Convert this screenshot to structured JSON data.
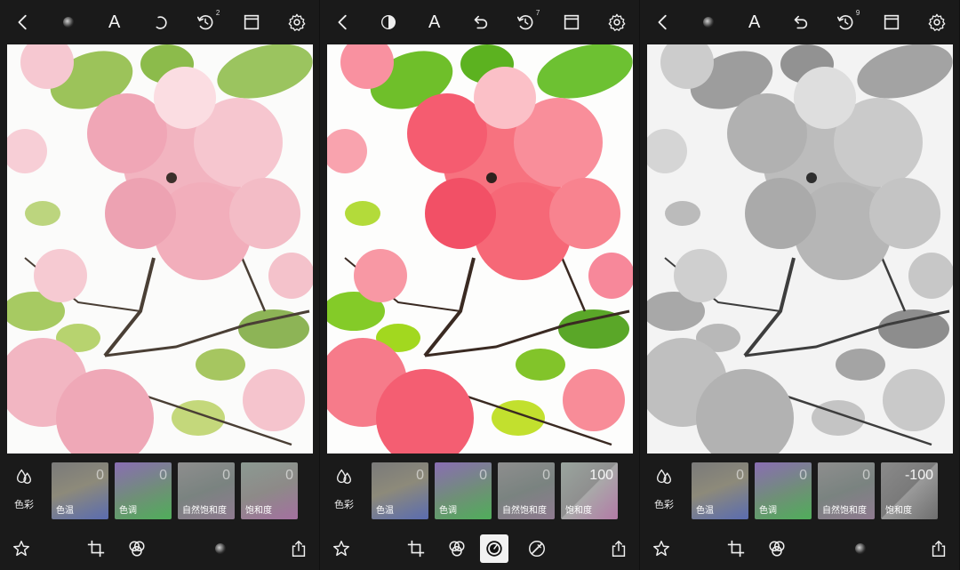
{
  "screens": [
    {
      "topbar": {
        "history_badge": "2"
      },
      "adjust": {
        "category_label": "色彩",
        "tiles": [
          {
            "label": "色温",
            "value": "0"
          },
          {
            "label": "色调",
            "value": "0"
          },
          {
            "label": "自然饱和度",
            "value": "0"
          },
          {
            "label": "饱和度",
            "value": "0"
          }
        ]
      }
    },
    {
      "topbar": {
        "history_badge": "7"
      },
      "adjust": {
        "category_label": "色彩",
        "tiles": [
          {
            "label": "色温",
            "value": "0"
          },
          {
            "label": "色调",
            "value": "0"
          },
          {
            "label": "自然饱和度",
            "value": "0"
          },
          {
            "label": "饱和度",
            "value": "100"
          }
        ]
      }
    },
    {
      "topbar": {
        "history_badge": "9"
      },
      "adjust": {
        "category_label": "色彩",
        "tiles": [
          {
            "label": "色温",
            "value": "0"
          },
          {
            "label": "色调",
            "value": "0"
          },
          {
            "label": "自然饱和度",
            "value": "0"
          },
          {
            "label": "饱和度",
            "value": "-100"
          }
        ]
      }
    }
  ],
  "shared": {
    "text_tool_label": "A"
  },
  "icons": {
    "back": "chevron-left-icon",
    "text": "text-icon",
    "undo": "undo-icon",
    "history": "history-icon",
    "compare": "compare-split-icon",
    "settings": "gear-icon",
    "color": "droplets-icon",
    "favorite": "star-icon",
    "crop": "crop-icon",
    "filters": "filters-circles-icon",
    "adjust": "adjust-dial-icon",
    "retouch": "brush-icon",
    "share": "share-icon"
  },
  "colors": {
    "background": "#1a1a1a",
    "photo_bg": "#fbfbfb",
    "selected_tool_bg": "#f2f2f2"
  }
}
